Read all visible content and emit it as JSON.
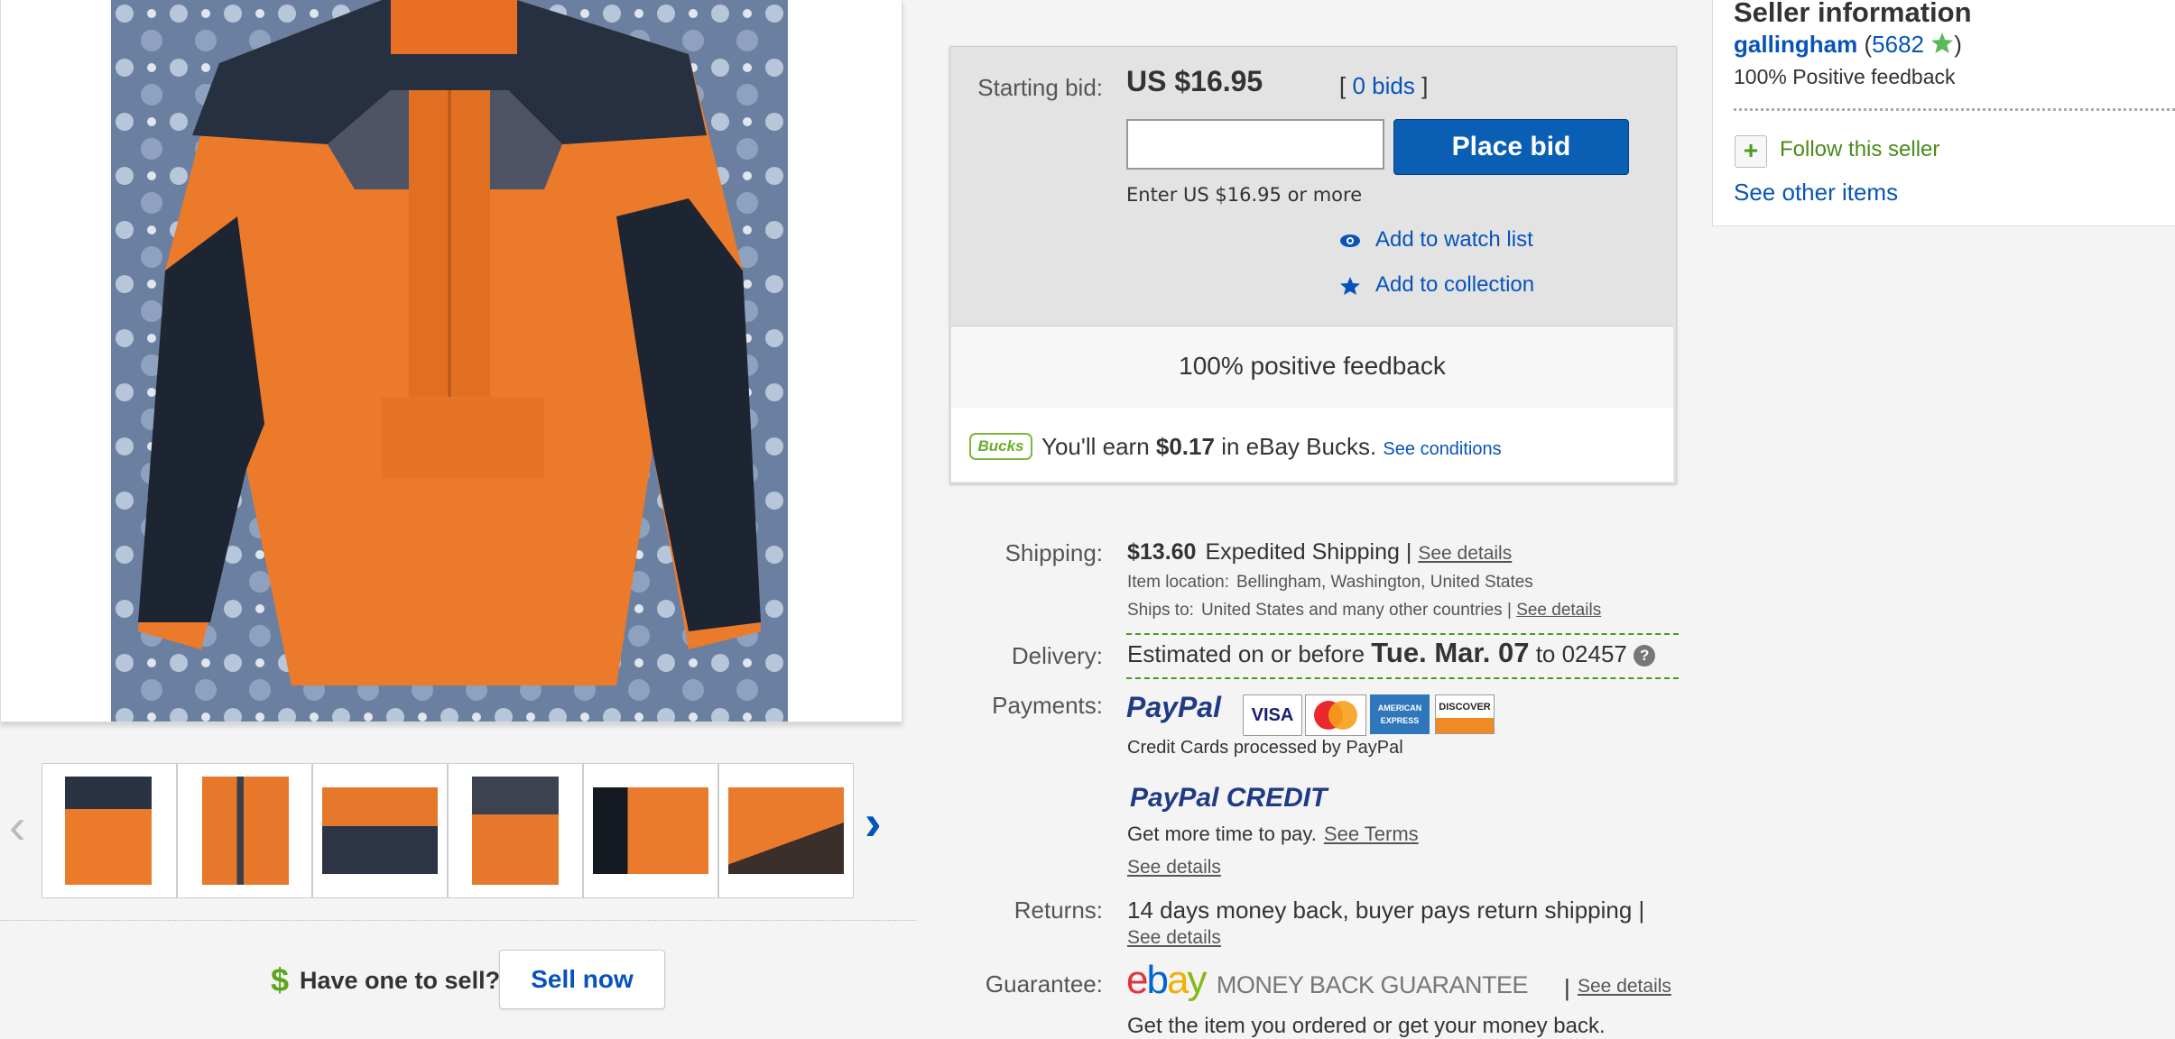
{
  "gallery": {
    "prev_arrow": "‹",
    "next_arrow": "›",
    "thumbnail_count": 6
  },
  "sell": {
    "icon": "$",
    "question": "Have one to sell?",
    "button": "Sell now"
  },
  "bid": {
    "starting_bid_label": "Starting bid:",
    "price": "US $16.95",
    "bids_open": "[",
    "bids_count": "0 bids",
    "bids_close": "]",
    "input_value": "",
    "place_bid_label": "Place bid",
    "hint": "Enter US $16.95 or more",
    "watch_label": "Add to watch list",
    "collection_label": "Add to collection",
    "feedback_text": "100% positive feedback",
    "bucks_badge": "Bucks",
    "bucks_pre": "You'll earn",
    "bucks_amount": "$0.17",
    "bucks_post": "in eBay Bucks.",
    "bucks_link": "See conditions"
  },
  "shipping": {
    "label": "Shipping:",
    "cost": "$13.60",
    "method": "Expedited Shipping |",
    "details_link": "See details",
    "location_label": "Item location:",
    "location": "Bellingham, Washington, United States",
    "ships_to_label": "Ships to:",
    "ships_to": "United States and many other countries |",
    "ships_to_link": "See details"
  },
  "delivery": {
    "label": "Delivery:",
    "prefix": "Estimated on or before",
    "date": "Tue. Mar. 07",
    "to_text": "to 02457",
    "help_icon": "?"
  },
  "payments": {
    "label": "Payments:",
    "paypal": "PayPal",
    "cards": [
      "VISA",
      "MasterCard",
      "AMERICAN EXPRESS",
      "DISCOVER"
    ],
    "processed_note": "Credit Cards processed by PayPal",
    "paypal_credit_1": "PayPal",
    "paypal_credit_2": "CREDIT",
    "credit_text": "Get more time to pay.",
    "credit_terms_link": "See Terms",
    "credit_details_link": "See details"
  },
  "returns": {
    "label": "Returns:",
    "text": "14 days money back, buyer pays return shipping |",
    "details_link": "See details"
  },
  "guarantee": {
    "label": "Guarantee:",
    "logo_e": "e",
    "logo_b": "b",
    "logo_a": "a",
    "logo_y": "y",
    "logo_text": "MONEY BACK GUARANTEE",
    "divider": "|",
    "details_link": "See details",
    "cutoff_text": "Get the item you ordered or get your money back."
  },
  "seller": {
    "heading": "Seller information",
    "name": "gallingham",
    "score_open": "(",
    "score": "5682",
    "score_close": ")",
    "positive": "100% Positive feedback",
    "follow_icon": "+",
    "follow_label": "Follow this seller",
    "other_items": "See other items"
  }
}
